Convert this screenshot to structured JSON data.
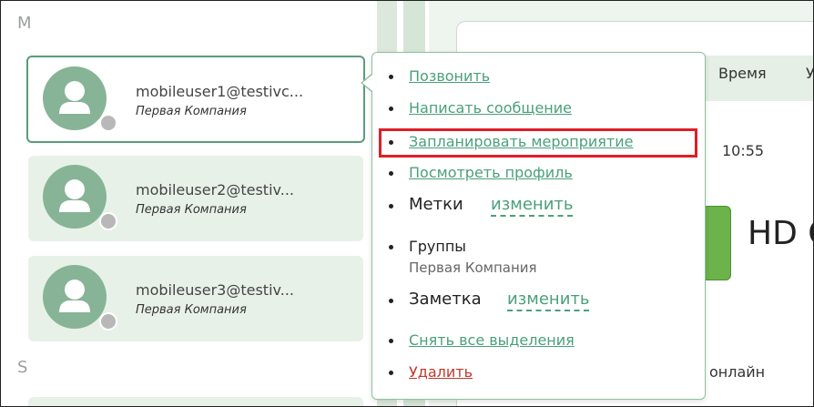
{
  "sections": {
    "m": "M",
    "s": "S"
  },
  "contacts": [
    {
      "email": "mobileuser1@testivc...",
      "company": "Первая Компания",
      "selected": true
    },
    {
      "email": "mobileuser2@testiv...",
      "company": "Первая Компания",
      "selected": false
    },
    {
      "email": "mobileuser3@testiv...",
      "company": "Первая Компания",
      "selected": false
    }
  ],
  "menu": {
    "call": "Позвонить",
    "message": "Написать сообщение",
    "schedule": "Запланировать мероприятие",
    "profile": "Посмотреть профиль",
    "tags_label": "Метки",
    "tags_edit": "изменить",
    "groups_label": "Группы",
    "groups_value": "Первая Компания",
    "note_label": "Заметка",
    "note_edit": "изменить",
    "clear_selection": "Снять все выделения",
    "delete": "Удалить"
  },
  "main": {
    "column_time": "Время",
    "column_next": "У",
    "row_time": "10:55",
    "hd_text": "HD C",
    "status": "онлайн"
  },
  "colors": {
    "accent": "#4aa07a",
    "danger": "#c0392b",
    "highlight": "#e01e26",
    "avatar": "#87b496"
  }
}
